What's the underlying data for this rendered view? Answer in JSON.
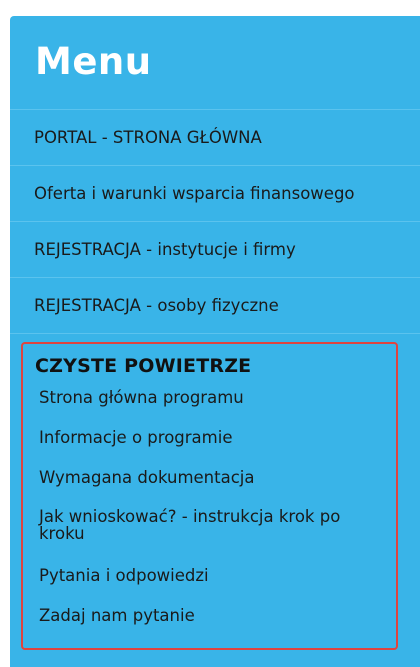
{
  "menu": {
    "title": "Menu",
    "items": [
      {
        "label": "PORTAL - STRONA GŁÓWNA"
      },
      {
        "label": "Oferta i warunki wsparcia finansowego"
      },
      {
        "label": "REJESTRACJA - instytucje i firmy"
      },
      {
        "label": "REJESTRACJA - osoby fizyczne"
      }
    ]
  },
  "program": {
    "title": "CZYSTE POWIETRZE",
    "items": [
      {
        "label": "Strona główna programu"
      },
      {
        "label": "Informacje o programie"
      },
      {
        "label": "Wymagana dokumentacja"
      },
      {
        "label": "Jak wnioskować? - instrukcja krok po kroku"
      },
      {
        "label": "Pytania i odpowiedzi"
      },
      {
        "label": "Zadaj nam pytanie"
      }
    ],
    "highlight_color": "#e0443e"
  },
  "colors": {
    "panel_background": "#39b4e8",
    "title_text": "#ffffff",
    "item_text": "#1a1a1a"
  }
}
